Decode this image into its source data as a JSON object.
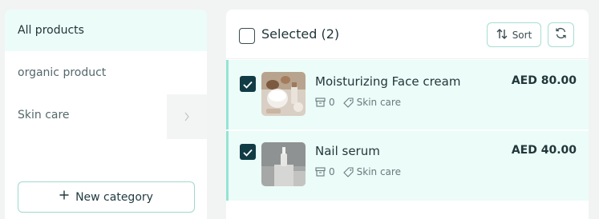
{
  "sidebar": {
    "categories": [
      {
        "label": "All products",
        "active": true
      },
      {
        "label": "organic product",
        "active": false
      },
      {
        "label": "Skin care",
        "active": false
      }
    ],
    "new_category_label": "New category"
  },
  "panel": {
    "selected_label": "Selected (2)",
    "sort_label": "Sort",
    "products": [
      {
        "name": "Moisturizing Face cream",
        "price": "AED 80.00",
        "stock": "0",
        "category": "Skin care",
        "checked": true
      },
      {
        "name": "Nail serum",
        "price": "AED 40.00",
        "stock": "0",
        "category": "Skin care",
        "checked": true
      }
    ]
  },
  "colors": {
    "accent_border": "#a7ddd3",
    "selected_row_bg": "#ecfcf8",
    "checkbox_dark": "#123c45"
  },
  "icons": [
    "sort-icon",
    "refresh-icon",
    "check-icon",
    "box-icon",
    "tag-icon",
    "chevron-right-icon",
    "plus-icon"
  ]
}
